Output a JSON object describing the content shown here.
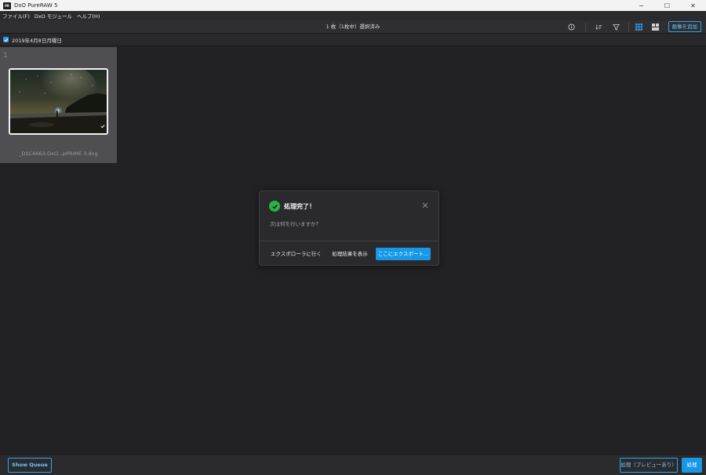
{
  "window": {
    "logo_text": "PR",
    "title": "DxO PureRAW 5",
    "minimize_glyph": "─",
    "maximize_glyph": "☐",
    "close_glyph": "✕"
  },
  "menu": {
    "items": [
      {
        "label": "ファイル(F)"
      },
      {
        "label": "DxO モジュール"
      },
      {
        "label": "ヘルプ(H)"
      }
    ]
  },
  "toolbar": {
    "selection_status": "1 枚（1枚中）選択済み",
    "icons": [
      "info-icon",
      "sort-icon",
      "filter-icon",
      "grid-view-icon",
      "compare-view-icon"
    ],
    "add_image_label": "画像を追加"
  },
  "group": {
    "date_label": "2019年4月8日月曜日",
    "checked": true
  },
  "thumbnail": {
    "index": "1",
    "filename": "_DSC6663-DxO...pPRIME 3.dng"
  },
  "dialog": {
    "title": "処理完了！",
    "message": "次は何を行いますか？",
    "buttons": {
      "go_explorer": "エクスポローラに行く",
      "show_results": "処理結果を表示",
      "export_here": "ここにエクスポート..."
    }
  },
  "bottom": {
    "show_queue": "Show Queue",
    "process_preview": "処理（プレビューあり）",
    "process": "処理"
  },
  "colors": {
    "accent": "#1797e8",
    "success": "#27b24a",
    "background": "#222224"
  }
}
